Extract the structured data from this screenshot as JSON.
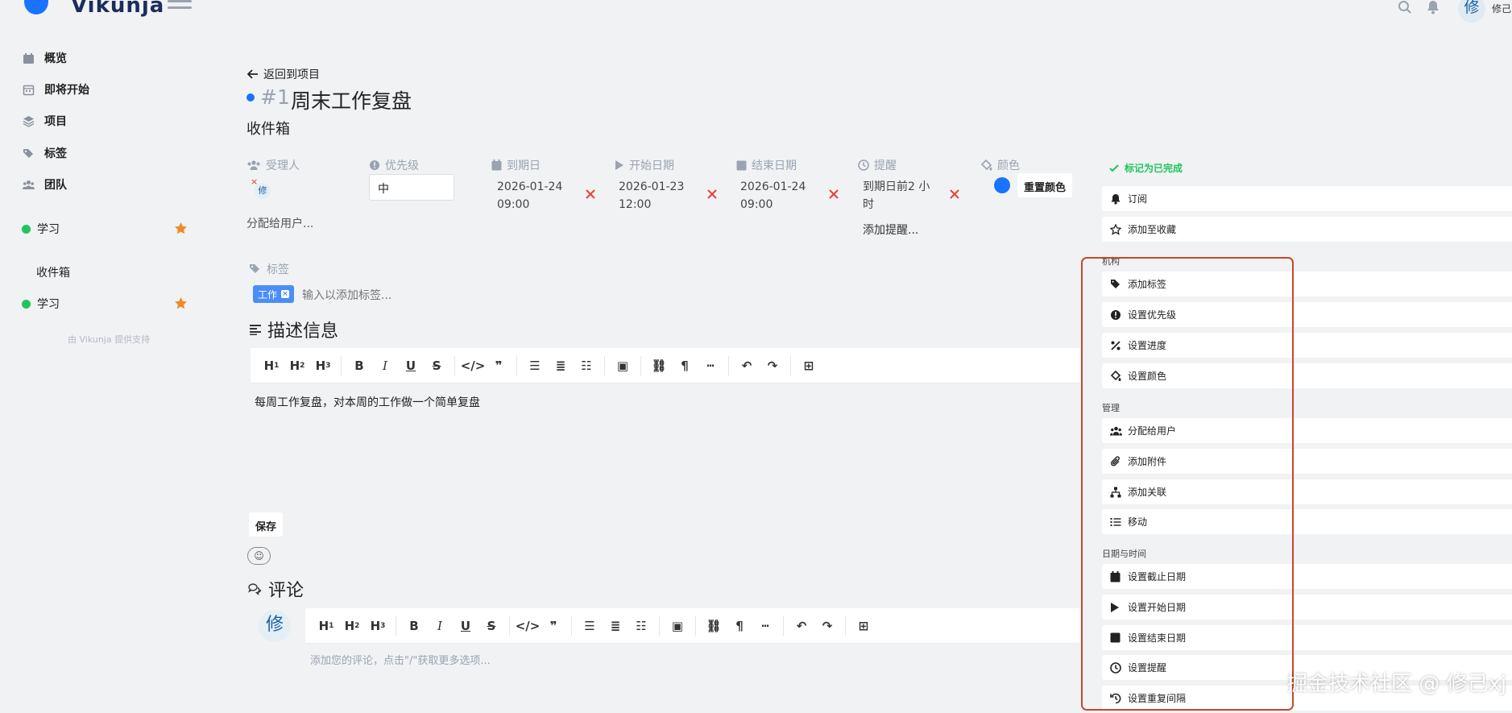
{
  "app": {
    "name": "Vikunja"
  },
  "header": {
    "avatar_initial": "修",
    "user_name": "修己"
  },
  "sidebar": {
    "items": [
      {
        "label": "概览",
        "icon": "calendar-icon"
      },
      {
        "label": "即将开始",
        "icon": "calendar-grid-icon"
      },
      {
        "label": "项目",
        "icon": "layers-icon"
      },
      {
        "label": "标签",
        "icon": "tags-icon"
      },
      {
        "label": "团队",
        "icon": "users-icon"
      }
    ],
    "projects": [
      {
        "label": "学习",
        "favorite": true,
        "color": "#1fc55e"
      },
      {
        "label": "收件箱",
        "favorite": false
      },
      {
        "label": "学习",
        "favorite": true,
        "color": "#1fc55e"
      }
    ],
    "footer": "由 Vikunja 提供支持"
  },
  "task": {
    "back_label": "返回到项目",
    "number": "#1",
    "title": "周末工作复盘",
    "project": "收件箱",
    "color": "#1973ff"
  },
  "attributes": {
    "assignee": {
      "label": "受理人",
      "avatar": "修",
      "add_label": "分配给用户..."
    },
    "priority": {
      "label": "优先级",
      "value": "中"
    },
    "due_date": {
      "label": "到期日",
      "date": "2026-01-24",
      "time": "09:00"
    },
    "start_date": {
      "label": "开始日期",
      "date": "2026-01-23",
      "time": "12:00"
    },
    "end_date": {
      "label": "结束日期",
      "date": "2026-01-24",
      "time": "09:00"
    },
    "reminder": {
      "label": "提醒",
      "line1": "到期日前2 小",
      "line2": "时",
      "add_label": "添加提醒..."
    },
    "color": {
      "label": "颜色",
      "reset_label": "重置颜色"
    }
  },
  "labels": {
    "heading": "标签",
    "chip": "工作",
    "placeholder": "输入以添加标签..."
  },
  "description": {
    "heading": "描述信息",
    "text": "每周工作复盘，对本周的工作做一个简单复盘",
    "save_label": "保存"
  },
  "comments": {
    "heading": "评论",
    "avatar": "修",
    "placeholder": "添加您的评论，点击\"/\"获取更多选项..."
  },
  "editor_toolbar": {
    "h1": "H",
    "h2": "H",
    "h3": "H",
    "sub1": "1",
    "sub2": "2",
    "sub3": "3",
    "bold": "B",
    "italic": "I",
    "underline": "U",
    "strike": "S"
  },
  "actions": {
    "done": "标记为已完成",
    "subscribe": "订阅",
    "favorite": "添加至收藏",
    "group_org": "机构",
    "add_labels": "添加标签",
    "set_priority": "设置优先级",
    "set_progress": "设置进度",
    "set_color": "设置颜色",
    "group_manage": "管理",
    "assign": "分配给用户",
    "attach": "添加附件",
    "relate": "添加关联",
    "move": "移动",
    "group_dates": "日期与时间",
    "set_due": "设置截止日期",
    "set_start": "设置开始日期",
    "set_end": "设置结束日期",
    "set_reminder": "设置提醒",
    "set_repeat": "设置重复间隔",
    "done_color": "#1fc55e"
  },
  "watermark": "掘金技术社区 @ 修己xj"
}
